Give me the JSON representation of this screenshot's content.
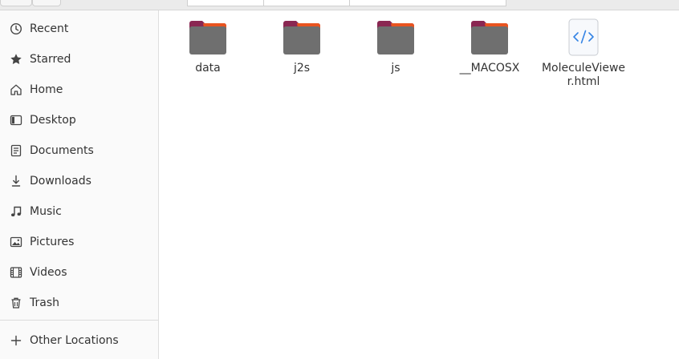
{
  "sidebar": {
    "items": [
      {
        "label": "Recent",
        "icon": "clock-icon"
      },
      {
        "label": "Starred",
        "icon": "star-icon"
      },
      {
        "label": "Home",
        "icon": "home-icon"
      },
      {
        "label": "Desktop",
        "icon": "desktop-icon"
      },
      {
        "label": "Documents",
        "icon": "document-icon"
      },
      {
        "label": "Downloads",
        "icon": "download-icon"
      },
      {
        "label": "Music",
        "icon": "music-icon"
      },
      {
        "label": "Pictures",
        "icon": "pictures-icon"
      },
      {
        "label": "Videos",
        "icon": "video-icon"
      },
      {
        "label": "Trash",
        "icon": "trash-icon"
      }
    ],
    "other_locations": {
      "label": "Other Locations",
      "icon": "plus-icon"
    }
  },
  "files": [
    {
      "name": "data",
      "type": "folder"
    },
    {
      "name": "j2s",
      "type": "folder"
    },
    {
      "name": "js",
      "type": "folder"
    },
    {
      "name": "__MACOSX",
      "type": "folder"
    },
    {
      "name": "MoleculeViewer.html",
      "type": "html-file"
    }
  ],
  "colors": {
    "folder_body": "#6f6f6f",
    "folder_tab": "#8a2752",
    "folder_accent": "#e95420",
    "code_icon": "#3584e4"
  }
}
